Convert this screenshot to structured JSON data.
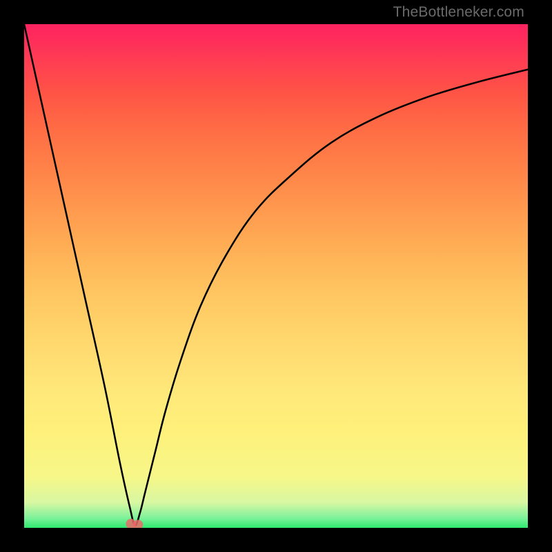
{
  "watermark": "TheBottleneker.com",
  "chart_data": {
    "type": "line",
    "title": "",
    "xlabel": "",
    "ylabel": "",
    "xlim": [
      0,
      100
    ],
    "ylim": [
      0,
      100
    ],
    "notes": "No axes, ticks, gridlines, or numeric labels are shown in the image. Values are relative percentages of the visible plot area. Curve depicts a V-shaped function: steep linear descent from top-left to a minimum near x≈22, then asymptotic rise toward the right. Two small pink markers sit at the minimum. Background is a vertical heat gradient (green at bottom, red at top).",
    "series": [
      {
        "name": "bottleneck-curve",
        "x": [
          0,
          4,
          8,
          12,
          16,
          19,
          21,
          22,
          23,
          24,
          26,
          28,
          31,
          35,
          40,
          46,
          53,
          61,
          70,
          80,
          90,
          100
        ],
        "y": [
          100,
          82,
          64,
          46,
          28,
          13,
          4,
          0.5,
          3,
          7,
          15,
          23,
          33,
          44,
          54,
          63,
          70,
          76.5,
          81.5,
          85.5,
          88.5,
          91
        ]
      }
    ],
    "markers": [
      {
        "name": "min-marker-a",
        "x": 21.2,
        "y": 0.8,
        "color": "#ea6a6a",
        "r": 1.0
      },
      {
        "name": "min-marker-b",
        "x": 22.6,
        "y": 0.6,
        "color": "#ea6a6a",
        "r": 1.0
      }
    ],
    "gradient_stops": [
      {
        "pct": 0,
        "color": "#2ee86f"
      },
      {
        "pct": 2,
        "color": "#7ef29a"
      },
      {
        "pct": 5,
        "color": "#d8f7a3"
      },
      {
        "pct": 10,
        "color": "#f6f788"
      },
      {
        "pct": 27,
        "color": "#ffe87a"
      },
      {
        "pct": 47,
        "color": "#ffc560"
      },
      {
        "pct": 71,
        "color": "#ff8348"
      },
      {
        "pct": 92,
        "color": "#ff4052"
      },
      {
        "pct": 100,
        "color": "#fd2360"
      }
    ]
  }
}
